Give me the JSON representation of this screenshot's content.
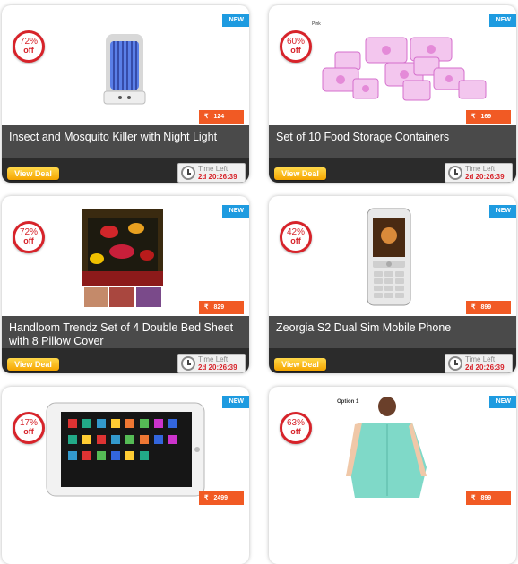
{
  "common": {
    "new_badge": "NEW",
    "off_label": "off",
    "rupee_symbol": "₹",
    "view_deal_label": "View Deal",
    "time_left_label": "Time Left",
    "time_left_value": "2d 20:26:39"
  },
  "deals": [
    {
      "discount": "72%",
      "price": "124",
      "title": "Insect and Mosquito Killer with Night Light"
    },
    {
      "discount": "60%",
      "price": "169",
      "title": "Set of 10 Food Storage Containers",
      "image_label": "Pink"
    },
    {
      "discount": "72%",
      "price": "829",
      "title": "Handloom Trendz Set of 4 Double Bed Sheet with 8 Pillow Cover"
    },
    {
      "discount": "42%",
      "price": "899",
      "title": "Zeorgia S2 Dual Sim Mobile Phone"
    },
    {
      "discount": "17%",
      "price": "2499",
      "title": ""
    },
    {
      "discount": "63%",
      "price": "899",
      "title": "",
      "image_label": "Option 1"
    }
  ],
  "colors": {
    "new_badge": "#1e9be0",
    "price_tag": "#f15a24",
    "discount_ring": "#d7232a",
    "title_bar": "#4a4a4a"
  }
}
